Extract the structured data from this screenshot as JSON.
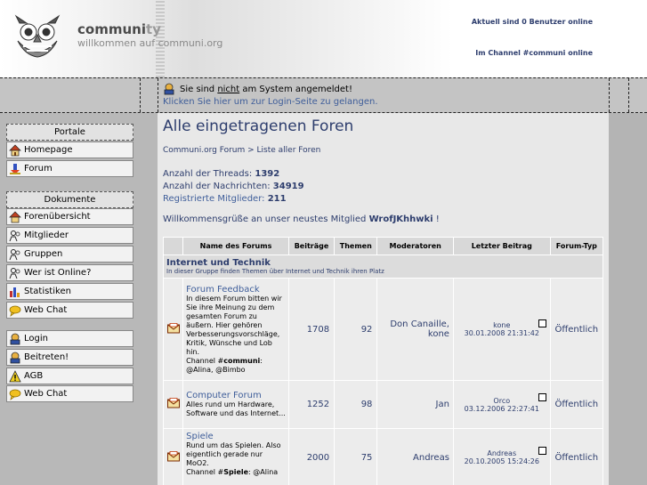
{
  "header": {
    "brand_title_main": "communi",
    "brand_title_tail": "ty",
    "brand_subtitle": "willkommen auf communi.org",
    "online_users": "Aktuell sind 0 Benutzer online",
    "channel_online": "Im Channel #communi online"
  },
  "login_notice": {
    "prefix": "Sie sind ",
    "link": "nicht",
    "suffix": " am System angemeldet!",
    "hint": "Klicken Sie hier um zur Login-Seite zu gelangen."
  },
  "sidebar": {
    "portale_header": "Portale",
    "portale_items": [
      {
        "label": "Homepage",
        "icon": "house-icon"
      },
      {
        "label": "Forum",
        "icon": "forum-icon"
      }
    ],
    "dokumente_header": "Dokumente",
    "dokumente_items": [
      {
        "label": "Forenübersicht",
        "icon": "house-icon"
      },
      {
        "label": "Mitglieder",
        "icon": "users-icon"
      },
      {
        "label": "Gruppen",
        "icon": "users-icon"
      },
      {
        "label": "Wer ist Online?",
        "icon": "users-icon"
      },
      {
        "label": "Statistiken",
        "icon": "chart-icon"
      },
      {
        "label": "Web Chat",
        "icon": "chat-icon"
      }
    ],
    "account_items": [
      {
        "label": "Login",
        "icon": "login-icon"
      },
      {
        "label": "Beitreten!",
        "icon": "login-icon"
      },
      {
        "label": "AGB",
        "icon": "warning-icon"
      },
      {
        "label": "Web Chat",
        "icon": "chat-icon"
      }
    ]
  },
  "main": {
    "title": "Alle eingetragenen Foren",
    "breadcrumb": {
      "home": "Communi.org Forum",
      "separator": " > ",
      "current": "Liste aller Foren"
    },
    "stats": {
      "threads_label": "Anzahl der Threads: ",
      "threads_value": "1392",
      "posts_label": "Anzahl der Nachrichten: ",
      "posts_value": "34919",
      "members_label": "Registrierte Mitglieder: ",
      "members_value": "211"
    },
    "welcome": {
      "prefix": "Willkommensgrüße an unser neustes Mitglied ",
      "member": "WrofJKhhwki",
      "suffix": " !"
    },
    "table": {
      "headers": [
        "Name des Forums",
        "Beiträge",
        "Themen",
        "Moderatoren",
        "Letzter Beitrag",
        "Forum-Typ"
      ],
      "category": {
        "title": "Internet und Technik",
        "description": "In dieser Gruppe finden Themen über Internet und Technik ihren Platz"
      },
      "rows": [
        {
          "name": "Forum Feedback",
          "description": "In diesem Forum bitten wir Sie ihre Meinung zu dem gesamten Forum zu äußern. Hier gehören Verbesserungsvorschläge, Kritik, Wünsche und Lob hin.",
          "channel_prefix": "Channel #",
          "channel_name": "communi",
          "channel_suffix": ":",
          "channel_users": "@Alina, @Bimbo",
          "posts": "1708",
          "topics": "92",
          "moderators": "Don Canaille, kone",
          "last_user": "kone",
          "last_date": "30.01.2008 21:31:42",
          "type": "Öffentlich"
        },
        {
          "name": "Computer Forum",
          "description": "Alles rund um Hardware, Software und das Internet...",
          "posts": "1252",
          "topics": "98",
          "moderators": "Jan",
          "last_user": "Orco",
          "last_date": "03.12.2006 22:27:41",
          "type": "Öffentlich"
        },
        {
          "name": "Spiele",
          "description": "Rund um das Spielen. Also eigentlich gerade nur MoO2.",
          "channel_prefix": "Channel #",
          "channel_name": "Spiele",
          "channel_suffix": ":",
          "channel_users": "@Alina",
          "posts": "2000",
          "topics": "75",
          "moderators": "Andreas",
          "last_user": "Andreas",
          "last_date": "20.10.2005 15:24:26",
          "type": "Öffentlich"
        }
      ]
    }
  },
  "colors": {
    "link_blue": "#2d3d6d",
    "light_link": "#3f5e9a",
    "sidebar_bg": "#b8b8b8",
    "content_bg": "#e8e8e8"
  }
}
